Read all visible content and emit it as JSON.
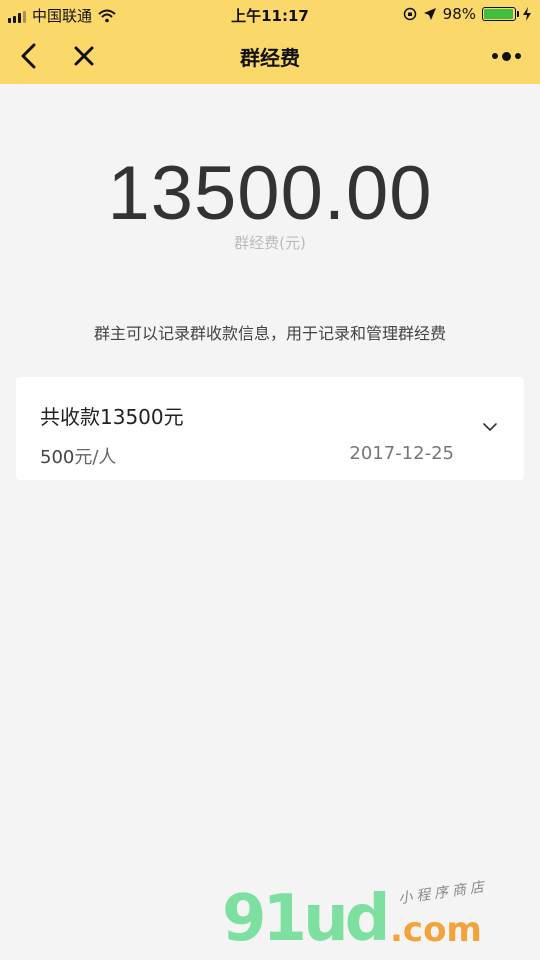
{
  "status_bar": {
    "carrier": "中国联通",
    "time": "上午11:17",
    "battery": "98%"
  },
  "nav": {
    "title": "群经费"
  },
  "summary": {
    "amount": "13500.00",
    "label": "群经费(元)",
    "description": "群主可以记录群收款信息，用于记录和管理群经费"
  },
  "record": {
    "title": "共收款13500元",
    "rate_value": "500",
    "rate_unit": "元/人",
    "date": "2017-12-25"
  },
  "watermark": {
    "brand": "91ud",
    "domain": ".com",
    "tagline": "小程序商店"
  },
  "colors": {
    "header_bg": "#fad96a",
    "page_bg": "#f4f4f4",
    "battery_fill": "#3fbf3f"
  }
}
